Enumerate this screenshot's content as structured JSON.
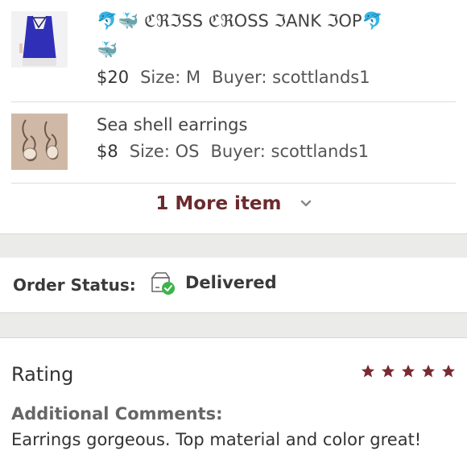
{
  "items": [
    {
      "title_line1": "🐬🐳 ℭℜℑSS ℭℜOSS ℑANK ℑOP🐬",
      "title_line2": "🐳",
      "price": "$20",
      "size": "Size: M",
      "buyer": "Buyer: scottlands1",
      "thumb": "blue-tank-top-photo"
    },
    {
      "title_line1": "Sea shell earrings",
      "price": "$8",
      "size": "Size: OS",
      "buyer": "Buyer: scottlands1",
      "thumb": "seashell-earrings-photo"
    }
  ],
  "more_items": {
    "label": "1 More item",
    "icon": "chevron-down-icon"
  },
  "order_status": {
    "label": "Order Status:",
    "value": "Delivered",
    "icon": "delivered-box-check-icon"
  },
  "rating": {
    "label": "Rating",
    "stars": 5,
    "star_color": "#7a2a30",
    "comments_label": "Additional Comments:",
    "comments": "Earrings gorgeous. Top material and color great!"
  },
  "colors": {
    "accent": "#6b2a2e",
    "band": "#ebebea",
    "status_check": "#3cb44a"
  }
}
